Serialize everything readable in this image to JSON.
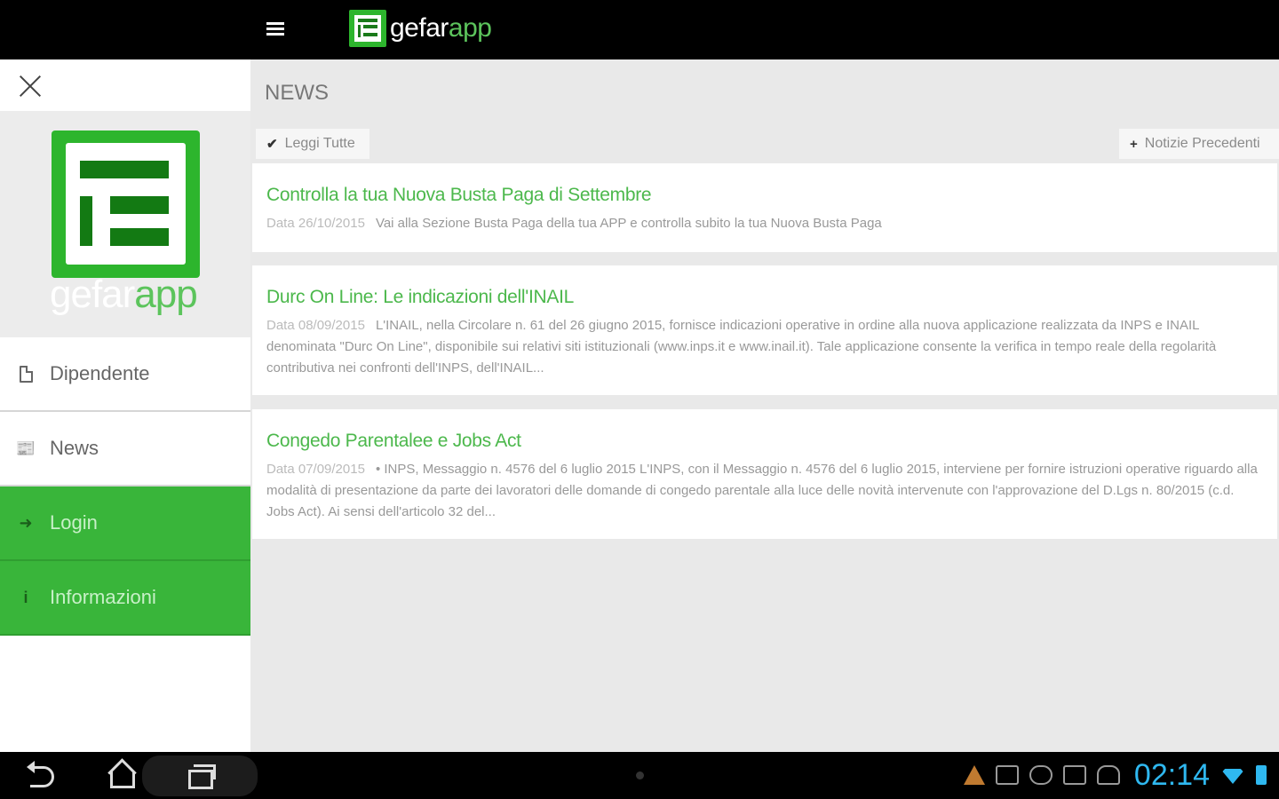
{
  "app": {
    "brand_part1": "gefar",
    "brand_part2": "app"
  },
  "sidebar": {
    "items": [
      {
        "label": "Dipendente",
        "icon": "document-icon"
      },
      {
        "label": "News",
        "icon": "newspaper-icon"
      },
      {
        "label": "Login",
        "icon": "login-icon"
      },
      {
        "label": "Informazioni",
        "icon": "info-icon"
      }
    ]
  },
  "main": {
    "title": "NEWS",
    "read_all_label": "Leggi Tutte",
    "previous_news_label": "Notizie Precedenti",
    "news": [
      {
        "title": "Controlla la tua Nuova Busta Paga di Settembre",
        "date": "Data 26/10/2015",
        "text": "Vai alla Sezione Busta Paga della tua APP e controlla subito la tua Nuova Busta Paga"
      },
      {
        "title": "Durc On Line: Le indicazioni dell'INAIL",
        "date": "Data 08/09/2015",
        "text": "L'INAIL, nella Circolare n. 61 del 26 giugno 2015, fornisce indicazioni operative in ordine alla nuova applicazione realizzata da INPS e INAIL denominata \"Durc On Line\", disponibile sui relativi siti istituzionali (www.inps.it e www.inail.it). Tale applicazione consente la verifica in tempo reale della regolarità contributiva nei confronti dell'INPS, dell'INAIL..."
      },
      {
        "title": "Congedo Parentalee e Jobs Act",
        "date": "Data 07/09/2015",
        "text": "• INPS, Messaggio n. 4576 del 6 luglio 2015 L'INPS, con il Messaggio n. 4576 del 6 luglio 2015, interviene per fornire istruzioni operative riguardo alla modalità di presentazione da parte dei lavoratori delle domande di congedo parentale alla luce delle novità intervenute con l'approvazione del D.Lgs n. 80/2015 (c.d. Jobs Act). Ai sensi dell'articolo 32 del..."
      }
    ]
  },
  "statusbar": {
    "time": "02:14"
  },
  "colors": {
    "accent_green": "#39b53a",
    "headline_green": "#4cb84c",
    "clock_blue": "#2fb8f0"
  }
}
